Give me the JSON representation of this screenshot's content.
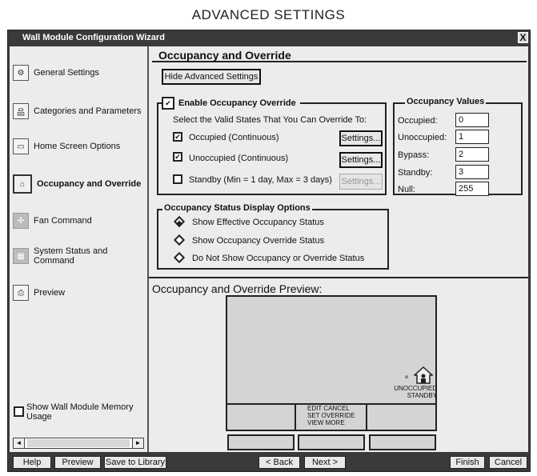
{
  "page_title": "ADVANCED SETTINGS",
  "window": {
    "title": "Wall Module Configuration Wizard",
    "close_label": "X"
  },
  "sidebar": {
    "items": [
      {
        "label": "General Settings",
        "icon": "settings-icon"
      },
      {
        "label": "Categories and Parameters",
        "icon": "hierarchy-icon"
      },
      {
        "label": "Home Screen Options",
        "icon": "screen-icon"
      },
      {
        "label": "Occupancy and Override",
        "icon": "house-icon",
        "active": true
      },
      {
        "label": "Fan Command",
        "icon": "fan-icon"
      },
      {
        "label": "System Status and Command",
        "icon": "status-icon"
      },
      {
        "label": "Preview",
        "icon": "preview-icon"
      }
    ],
    "memory_checkbox_label": "Show Wall Module Memory Usage",
    "scroll_left": "◄",
    "scroll_right": "►"
  },
  "main": {
    "section_title": "Occupancy and Override",
    "hide_advanced_button": "Hide Advanced Settings",
    "override": {
      "enable_label": "Enable Occupancy Override",
      "instructions": "Select the Valid States That You Can Override To:",
      "options": [
        {
          "label": "Occupied (Continuous)",
          "checked": true,
          "settings": "Settings...",
          "enabled": true
        },
        {
          "label": "Unoccupied (Continuous)",
          "checked": true,
          "settings": "Settings...",
          "enabled": true
        },
        {
          "label": "Standby (Min = 1 day, Max = 3 days)",
          "checked": false,
          "settings": "Settings...",
          "enabled": false
        }
      ]
    },
    "values": {
      "title": "Occupancy Values",
      "rows": [
        {
          "label": "Occupied:",
          "value": "0"
        },
        {
          "label": "Unoccupied:",
          "value": "1"
        },
        {
          "label": "Bypass:",
          "value": "2"
        },
        {
          "label": "Standby:",
          "value": "3"
        },
        {
          "label": "Null:",
          "value": "255"
        }
      ]
    },
    "display_options": {
      "title": "Occupancy Status Display Options",
      "options": [
        {
          "label": "Show Effective Occupancy Status",
          "selected": true
        },
        {
          "label": "Show Occupancy Override Status",
          "selected": false
        },
        {
          "label": "Do Not Show Occupancy or Override Status",
          "selected": false
        }
      ]
    },
    "preview": {
      "title": "Occupancy and Override Preview:",
      "status_line1": "UNOCCUPIED",
      "status_line2": "STANDBY",
      "softkey_line1": "EDIT CANCEL",
      "softkey_line2": "SET OVERRIDE",
      "softkey_line3": "VIEW MORE"
    }
  },
  "footer": {
    "help": "Help",
    "preview": "Preview",
    "save": "Save to Library",
    "back": "< Back",
    "next": "Next >",
    "finish": "Finish",
    "cancel": "Cancel"
  }
}
